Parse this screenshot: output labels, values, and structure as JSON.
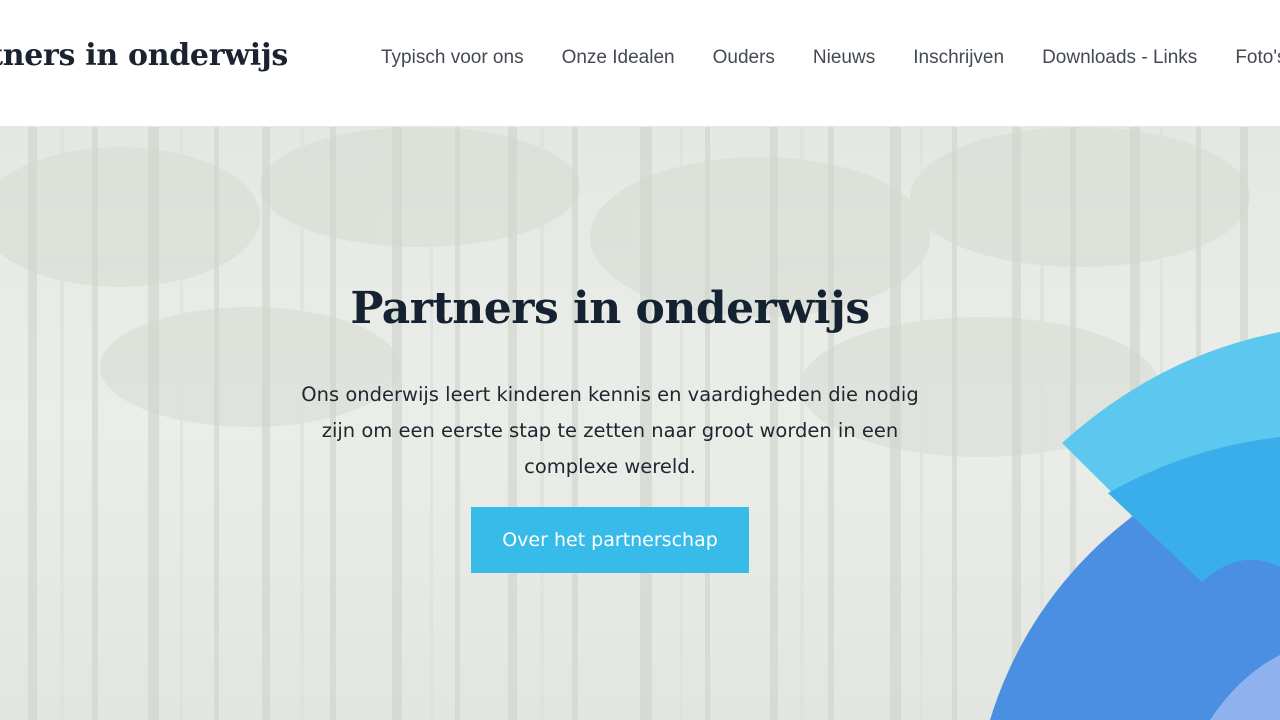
{
  "header": {
    "site_title": "Partners in onderwijs",
    "nav": [
      {
        "label": "Typisch voor ons"
      },
      {
        "label": "Onze Idealen"
      },
      {
        "label": "Ouders"
      },
      {
        "label": "Nieuws"
      },
      {
        "label": "Inschrijven"
      },
      {
        "label": "Downloads - Links"
      },
      {
        "label": "Foto's"
      }
    ]
  },
  "hero": {
    "title": "Partners in onderwijs",
    "text": "Ons onderwijs leert kinderen kennis en vaardigheden die nodig zijn om een eerste stap te zetten naar groot worden in een complexe wereld.",
    "cta_label": "Over het partnerschap",
    "background": "forest-image"
  },
  "colors": {
    "accent": "#37bbe9",
    "title": "#152232",
    "nav_text": "#444a52",
    "deco_light_blue": "#5cc8ef",
    "deco_sky_blue": "#3aaeea",
    "deco_blue": "#4a8fe2"
  }
}
